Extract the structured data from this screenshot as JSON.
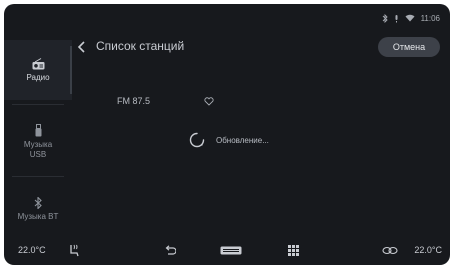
{
  "status_bar": {
    "time": "11:06",
    "icons": [
      "bluetooth-icon",
      "mute-icon",
      "wifi-icon"
    ]
  },
  "sidebar": {
    "items": [
      {
        "label": "Радио",
        "icon": "radio-icon",
        "active": true
      },
      {
        "label": "Музыка USB",
        "icon": "usb-icon",
        "active": false
      },
      {
        "label": "Музыка BT",
        "icon": "bluetooth-icon",
        "active": false
      }
    ]
  },
  "header": {
    "title": "Список станций",
    "cancel_label": "Отмена"
  },
  "station": {
    "name": "FM 87.5"
  },
  "loading": {
    "text": "Обновление..."
  },
  "bottom_bar": {
    "temp_left": "22.0°C",
    "temp_right": "22.0°C",
    "icons": [
      "seat-heat-icon",
      "back-icon",
      "hvac-icon",
      "apps-grid-icon",
      "recirculation-icon"
    ]
  },
  "colors": {
    "background": "#17191d",
    "active_item": "#202329",
    "button": "#3d4149",
    "text": "#c9ccd2"
  }
}
